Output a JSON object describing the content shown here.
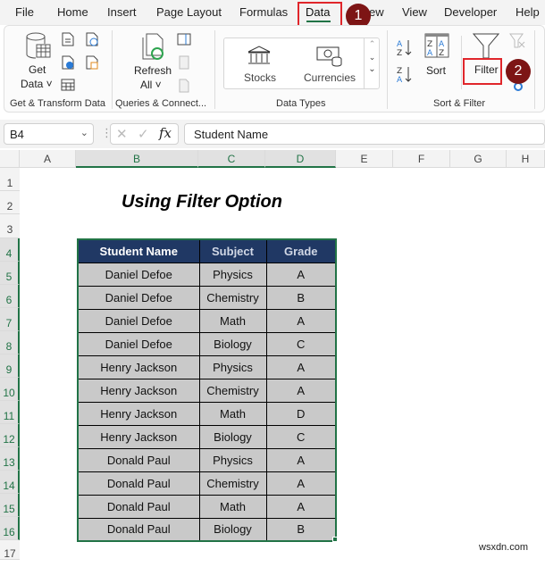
{
  "menu": {
    "tabs": [
      "File",
      "Home",
      "Insert",
      "Page Layout",
      "Formulas",
      "Data",
      "Review",
      "View",
      "Developer",
      "Help"
    ],
    "active_tab": "Data",
    "review_visible": "ew"
  },
  "annotations": {
    "step1": "1",
    "step2": "2",
    "highlight_color": "#e0262b",
    "badge_color": "#7d1515"
  },
  "ribbon": {
    "get_transform": {
      "get_data_line1": "Get",
      "get_data_line2": "Data ˅",
      "label": "Get & Transform Data"
    },
    "queries": {
      "refresh_line1": "Refresh",
      "refresh_line2": "All ˅",
      "label": "Queries & Connect..."
    },
    "data_types": {
      "stocks": "Stocks",
      "currencies": "Currencies",
      "label": "Data Types"
    },
    "sort_filter": {
      "sort": "Sort",
      "filter": "Filter",
      "label": "Sort & Filter"
    }
  },
  "formula_bar": {
    "name_box": "B4",
    "fx": "fx",
    "content": "Student Name"
  },
  "grid": {
    "columns": [
      "A",
      "B",
      "C",
      "D",
      "E",
      "F",
      "G",
      "H"
    ],
    "selected_columns": [
      "B",
      "C",
      "D"
    ],
    "rows": [
      "1",
      "2",
      "3",
      "4",
      "5",
      "6",
      "7",
      "8",
      "9",
      "10",
      "11",
      "12",
      "13",
      "14",
      "15",
      "16",
      "17"
    ],
    "accent": "#217346"
  },
  "sheet": {
    "title": "Using Filter Option",
    "table": {
      "headers": [
        "Student Name",
        "Subject",
        "Grade"
      ],
      "rows": [
        [
          "Daniel Defoe",
          "Physics",
          "A"
        ],
        [
          "Daniel Defoe",
          "Chemistry",
          "B"
        ],
        [
          "Daniel Defoe",
          "Math",
          "A"
        ],
        [
          "Daniel Defoe",
          "Biology",
          "C"
        ],
        [
          "Henry Jackson",
          "Physics",
          "A"
        ],
        [
          "Henry Jackson",
          "Chemistry",
          "A"
        ],
        [
          "Henry Jackson",
          "Math",
          "D"
        ],
        [
          "Henry Jackson",
          "Biology",
          "C"
        ],
        [
          "Donald Paul",
          "Physics",
          "A"
        ],
        [
          "Donald Paul",
          "Chemistry",
          "A"
        ],
        [
          "Donald Paul",
          "Math",
          "A"
        ],
        [
          "Donald Paul",
          "Biology",
          "B"
        ]
      ],
      "header_color": "#203864",
      "cell_color": "#c9c9c9"
    }
  },
  "watermark": "wsxdn.com"
}
